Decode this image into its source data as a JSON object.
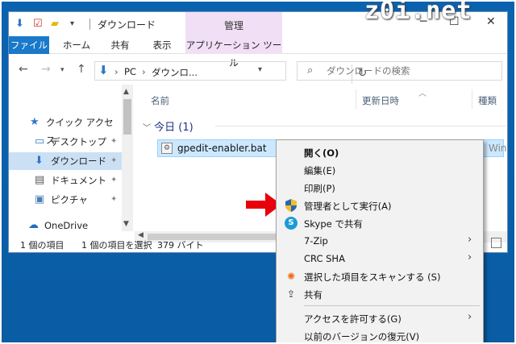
{
  "titlebar": {
    "title": "ダウンロード",
    "context_tab": "管理",
    "watermark": "z0i.net"
  },
  "ribbon": {
    "tabs": [
      "ファイル",
      "ホーム",
      "共有",
      "表示",
      "アプリケーション ツール"
    ]
  },
  "address": {
    "crumbs": [
      "PC",
      "ダウンロ..."
    ],
    "search_placeholder": "ダウンロードの検索"
  },
  "nav_pane": {
    "items": [
      {
        "label": "クイック アクセス",
        "icon": "star-icon"
      },
      {
        "label": "デスクトップ",
        "icon": "desktop-icon"
      },
      {
        "label": "ダウンロード",
        "icon": "download-icon"
      },
      {
        "label": "ドキュメント",
        "icon": "document-icon"
      },
      {
        "label": "ピクチャ",
        "icon": "picture-icon"
      },
      {
        "label": "OneDrive",
        "icon": "cloud-icon"
      }
    ]
  },
  "file_pane": {
    "columns": [
      "名前",
      "更新日時",
      "種類"
    ],
    "group": "今日 (1)",
    "file": {
      "name": "gpedit-enabler.bat",
      "type_fragment": "Windo"
    }
  },
  "statusbar": {
    "count": "1 個の項目",
    "selected": "1 個の項目を選択",
    "size": "379 バイト"
  },
  "context_menu": {
    "items": [
      {
        "label": "開く(O)",
        "bold": true
      },
      {
        "label": "編集(E)"
      },
      {
        "label": "印刷(P)"
      },
      {
        "label": "管理者として実行(A)",
        "icon": "shield-icon"
      },
      {
        "label": "Skype で共有",
        "icon": "skype-icon"
      },
      {
        "label": "7-Zip",
        "submenu": true
      },
      {
        "label": "CRC SHA",
        "submenu": true
      },
      {
        "label": "選択した項目をスキャンする (S)",
        "icon": "avast-icon"
      },
      {
        "label": "共有",
        "icon": "share-icon"
      },
      {
        "label": "アクセスを許可する(G)",
        "submenu": true
      },
      {
        "label": "以前のバージョンの復元(V)"
      }
    ]
  },
  "colors": {
    "desktop": "#0a5ea6",
    "file_tab": "#1979ca",
    "context_tab": "#f1dff6",
    "selection": "#cce8ff",
    "arrow": "#e8000b"
  }
}
